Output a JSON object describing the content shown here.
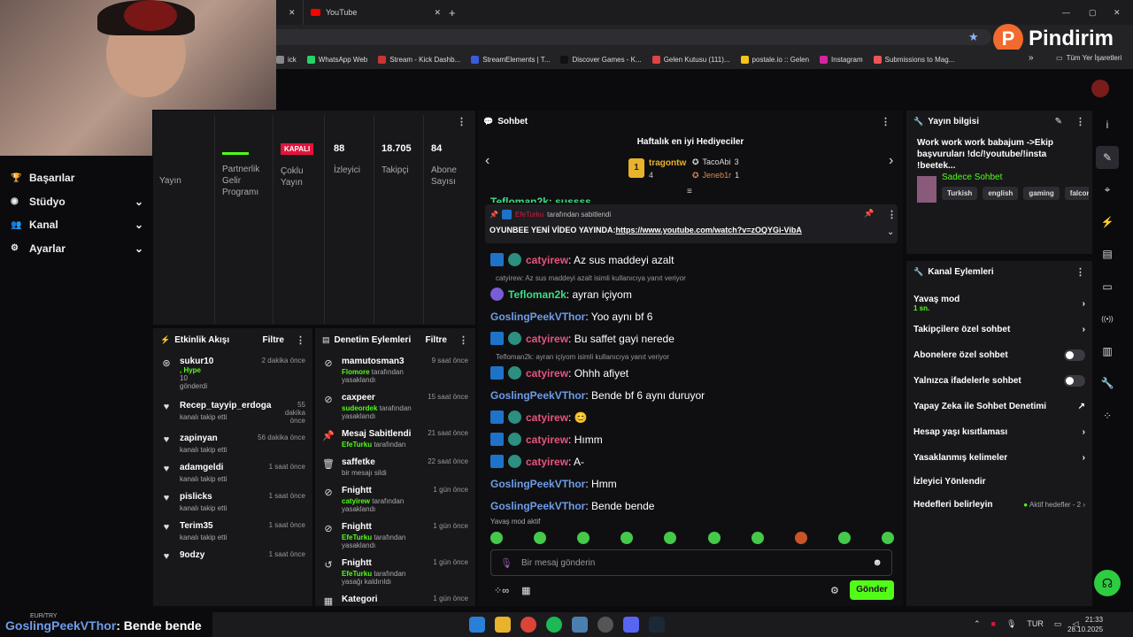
{
  "browser": {
    "tab_title": "YouTube",
    "window_controls": [
      "—",
      "▢",
      "✕"
    ],
    "new_tab": "+",
    "bookmarks": [
      {
        "label": "ick",
        "color": "#888"
      },
      {
        "label": "WhatsApp Web",
        "color": "#25d366"
      },
      {
        "label": "Stream - Kick Dashb...",
        "color": "#c33"
      },
      {
        "label": "StreamElements | T...",
        "color": "#3a5bd9"
      },
      {
        "label": "Discover Games - K...",
        "color": "#111"
      },
      {
        "label": "Gelen Kutusu (111)...",
        "color": "#d44"
      },
      {
        "label": "postale.io :: Gelen",
        "color": "#f5c518"
      },
      {
        "label": "Instagram",
        "color": "#d6249f"
      },
      {
        "label": "Submissions to Mag...",
        "color": "#e55"
      }
    ],
    "bookmarks_more": "»",
    "all_bookmarks": "Tüm Yer İşaretleri",
    "overlay_brand": "Pindirim",
    "overlay_letter": "P"
  },
  "sidebar": {
    "items": [
      {
        "label": "Başarılar",
        "icon": "trophy-icon",
        "glyph": "🏆",
        "chevron": ""
      },
      {
        "label": "Stüdyo",
        "icon": "studio-icon",
        "glyph": "◉",
        "chevron": "⌄"
      },
      {
        "label": "Kanal",
        "icon": "channel-icon",
        "glyph": "👥",
        "chevron": "⌄"
      },
      {
        "label": "Ayarlar",
        "icon": "settings-icon",
        "glyph": "⚙",
        "chevron": "⌄"
      }
    ]
  },
  "stats": {
    "badge": "KAPALI",
    "yayin": "Yayın",
    "partner": "Partnerlik Gelir Programı",
    "coklu": "Çoklu Yayın",
    "izleyici_num": "88",
    "izleyici_lbl": "İzleyici",
    "takipci_num": "18.705",
    "takipci_lbl": "Takipçi",
    "abone_num": "84",
    "abone_lbl": "Abone Sayısı"
  },
  "activity": {
    "title": "Etkinlik Akışı",
    "filter": "Filtre",
    "items": [
      {
        "user": "sukur10",
        "line2": ", Hype",
        "line3": "10",
        "line4": "gönderdi",
        "time": "2 dakika önce",
        "glyph": "⊛"
      },
      {
        "user": "Recep_tayyip_erdogannn",
        "sub": "kanalı takip etti",
        "time": "55 dakika önce",
        "glyph": "♥"
      },
      {
        "user": "zapinyan",
        "sub": "kanalı takip etti",
        "time": "56 dakika önce",
        "glyph": "♥"
      },
      {
        "user": "adamgeldi",
        "sub": "kanalı takip etti",
        "time": "1 saat önce",
        "glyph": "♥"
      },
      {
        "user": "pislicks",
        "sub": "kanalı takip etti",
        "time": "1 saat önce",
        "glyph": "♥"
      },
      {
        "user": "Terim35",
        "sub": "kanalı takip etti",
        "time": "1 saat önce",
        "glyph": "♥"
      },
      {
        "user": "9odzy",
        "sub": "",
        "time": "1 saat önce",
        "glyph": "♥"
      }
    ]
  },
  "moderation": {
    "title": "Denetim Eylemleri",
    "filter": "Filtre",
    "items": [
      {
        "user": "mamutosman3",
        "actor": "Flomore",
        "action": "tarafından yasaklandı",
        "time": "9 saat önce",
        "glyph": "⊘"
      },
      {
        "user": "caxpeer",
        "actor": "sudeordek",
        "action": "tarafından yasaklandı",
        "time": "15 saat önce",
        "glyph": "⊘"
      },
      {
        "user": "Mesaj Sabitlendi",
        "actor": "EfeTurku",
        "action": "tarafından",
        "time": "21 saat önce",
        "glyph": "📌"
      },
      {
        "user": "saffetke",
        "actor": "",
        "action": "bir mesajı sildi",
        "time": "22 saat önce",
        "glyph": "🗑"
      },
      {
        "user": "Fnightt",
        "actor": "catyirew",
        "action": "tarafından yasaklandı",
        "time": "1 gün önce",
        "glyph": "⊘"
      },
      {
        "user": "Fnightt",
        "actor": "EfeTurku",
        "action": "tarafından yasaklandı",
        "time": "1 gün önce",
        "glyph": "⊘"
      },
      {
        "user": "Fnightt",
        "actor": "EfeTurku",
        "action": "tarafından yasağı kaldırıldı",
        "time": "1 gün önce",
        "glyph": "↺"
      },
      {
        "user": "Kategori",
        "actor": "",
        "action": "",
        "time": "1 gün önce",
        "glyph": "▦"
      }
    ]
  },
  "chat": {
    "title": "Sohbet",
    "top_title": "Haftalık en iyi Hediyeciler",
    "top_first_name": "tragontw",
    "top_first_count": "4",
    "top_first_rank": "1",
    "top_second_name": "TacoAbi",
    "top_second_count": "3",
    "top_third_name": "Jeneb1r",
    "top_third_count": "1",
    "partial_line": "Tefloman2k: sussss",
    "pinned_by_user": "EfeTurku",
    "pinned_by_text": "tarafından sabitlendi",
    "pinned_prefix": "OYUNBEE YENİ VİDEO YAYINDA:",
    "pinned_link": "https://www.youtube.com/watch?v=zOQYGi-VibA",
    "slow_mode": "Yavaş mod aktif",
    "placeholder": "Bir mesaj gönderin",
    "send": "Gönder",
    "messages": [
      {
        "user": "catyirew",
        "color": "#e75480",
        "badges": true,
        "text": ": Az sus maddeyi azalt",
        "reply": ""
      },
      {
        "user": "Tefloman2k",
        "color": "#3ddc84",
        "badges": false,
        "avatar": true,
        "text": ": ayran içiyom",
        "reply": "catyirew: Az sus maddeyi azalt isimli kullanıcıya yanıt veriyor"
      },
      {
        "user": "GoslingPeekVThor",
        "color": "#6f9ce8",
        "badges": false,
        "text": ": Yoo aynı bf 6",
        "reply": ""
      },
      {
        "user": "catyirew",
        "color": "#e75480",
        "badges": true,
        "text": ": Bu saffet gayi nerede",
        "reply": ""
      },
      {
        "user": "catyirew",
        "color": "#e75480",
        "badges": true,
        "text": ": Ohhh afiyet",
        "reply": "Tefloman2k: ayran içiyom isimli kullanıcıya yanıt veriyor"
      },
      {
        "user": "GoslingPeekVThor",
        "color": "#6f9ce8",
        "badges": false,
        "text": ": Bende bf 6 aynı duruyor",
        "reply": ""
      },
      {
        "user": "catyirew",
        "color": "#e75480",
        "badges": true,
        "text": ": 😊",
        "reply": ""
      },
      {
        "user": "catyirew",
        "color": "#e75480",
        "badges": true,
        "text": ": Hımm",
        "reply": ""
      },
      {
        "user": "catyirew",
        "color": "#e75480",
        "badges": true,
        "text": ": A-",
        "reply": ""
      },
      {
        "user": "GoslingPeekVThor",
        "color": "#6f9ce8",
        "badges": false,
        "text": ": Hmm",
        "reply": ""
      },
      {
        "user": "GoslingPeekVThor",
        "color": "#6f9ce8",
        "badges": false,
        "text": ": Bende bende",
        "reply": ""
      }
    ]
  },
  "stream_info": {
    "title": "Yayın bilgisi",
    "text": "Work work work babajum ->Ekip başvuruları !dc/!youtube/!insta !beetek...",
    "category": "Sadece Sohbet",
    "tags": [
      "Turkish",
      "english",
      "gaming",
      "falcon"
    ]
  },
  "channel_actions": {
    "title": "Kanal Eylemleri",
    "slow": "Yavaş mod",
    "slow_value": "1 sn.",
    "followers": "Takipçilere özel sohbet",
    "subs": "Abonelere özel sohbet",
    "emotes": "Yalnızca ifadelerle sohbet",
    "ai": "Yapay Zeka ile Sohbet Denetimi",
    "age": "Hesap yaşı kısıtlaması",
    "banned": "Yasaklanmış kelimeler",
    "redirect": "İzleyici Yönlendir",
    "goals": "Hedefleri belirleyin",
    "goals_status": "Aktif hedefler - 2"
  },
  "rail_icons": [
    {
      "name": "info-icon",
      "glyph": "i"
    },
    {
      "name": "edit-icon",
      "glyph": "✎"
    },
    {
      "name": "capture-icon",
      "glyph": "⌖"
    },
    {
      "name": "bolt-icon",
      "glyph": "⚡"
    },
    {
      "name": "document-icon",
      "glyph": "▤"
    },
    {
      "name": "chat-icon",
      "glyph": "▭"
    },
    {
      "name": "broadcast-icon",
      "glyph": "((•))"
    },
    {
      "name": "layout-icon",
      "glyph": "▥"
    },
    {
      "name": "tools-icon",
      "glyph": "🔧"
    },
    {
      "name": "more-tools-icon",
      "glyph": "⁘"
    }
  ],
  "overlay": {
    "currency": "EUR/TRY",
    "ticker_user": "GoslingPeekVThor",
    "ticker_text": ": Bende bende"
  },
  "taskbar": {
    "lang": "TUR",
    "time": "21:33",
    "date": "28.10.2025"
  },
  "colors": {
    "accent": "#53fc18",
    "panel": "#18181b",
    "background": "#0b0b0d"
  }
}
